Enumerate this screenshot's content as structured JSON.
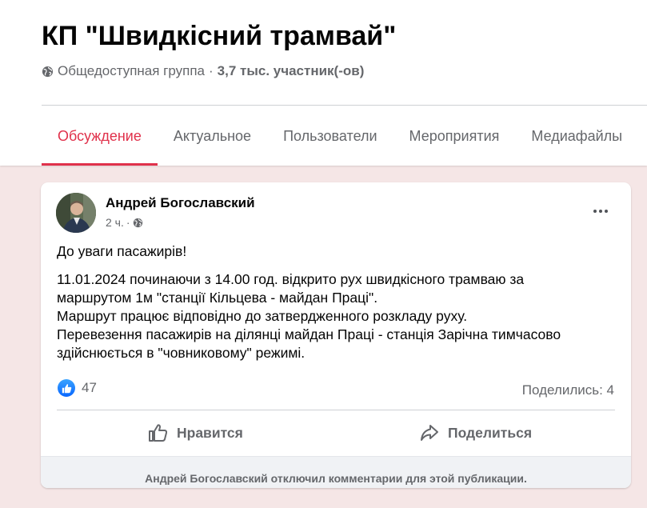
{
  "group": {
    "title": "КП \"Швидкісний трамвай\"",
    "privacy": "Общедоступная группа",
    "separator": "·",
    "members": "3,7 тыс. участник(-ов)"
  },
  "tabs": [
    {
      "label": "Обсуждение",
      "active": true
    },
    {
      "label": "Актуальное",
      "active": false
    },
    {
      "label": "Пользователи",
      "active": false
    },
    {
      "label": "Мероприятия",
      "active": false
    },
    {
      "label": "Медиафайлы",
      "active": false
    }
  ],
  "post": {
    "author": "Андрей Богославский",
    "time": "2 ч.",
    "meta_separator": "·",
    "paragraph1": "До уваги пасажирів!",
    "lines": [
      "11.01.2024 починаючи з 14.00 год. відкрито рух  швидкісного трамваю за",
      "маршрутом 1м \"станції Кільцева - майдан Праці\".",
      "Маршрут працює відповідно до затвердженного розкладу руху.",
      "Перевезення пасажирів на ділянці майдан Праці - станція Зарічна тимчасово",
      "здійснюється в \"човниковому\" режимі."
    ],
    "reaction_count": "47",
    "shares": "Поделились: 4",
    "like_label": "Нравится",
    "share_label": "Поделиться",
    "comments_disabled": "Андрей Богославский отключил комментарии для этой публикации."
  },
  "colors": {
    "accent": "#e0314b",
    "background": "#f5e6e6",
    "like_blue": "#0866ff"
  }
}
